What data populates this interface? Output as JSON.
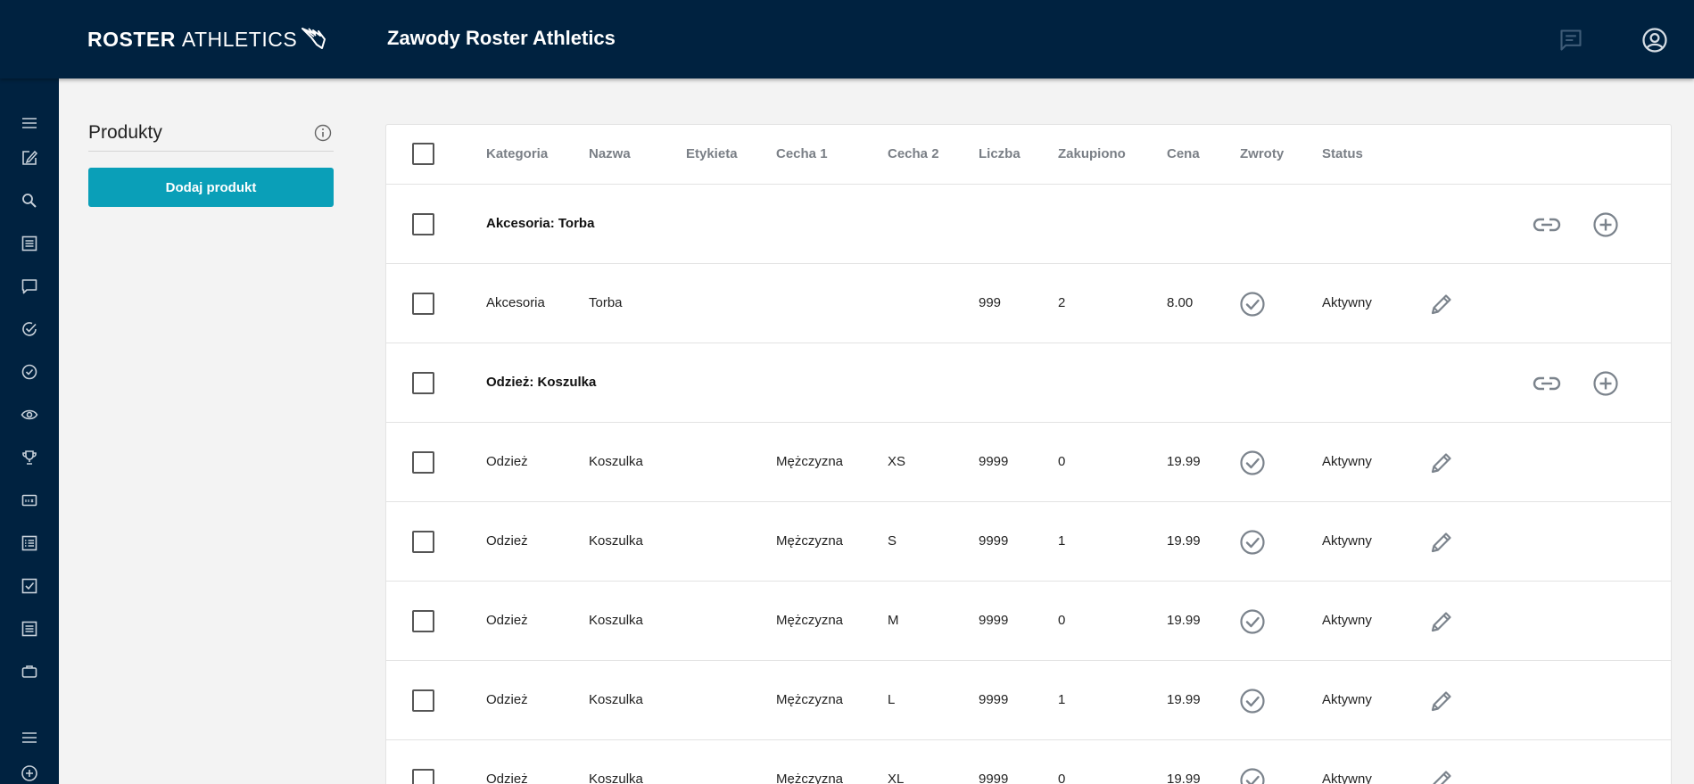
{
  "header": {
    "logo_bold": "ROSTER",
    "logo_light": "ATHLETICS",
    "title": "Zawody Roster Athletics",
    "icons": [
      "chat-icon",
      "account-icon"
    ]
  },
  "sidebar": {
    "icons": [
      "menu-icon",
      "edit-icon",
      "search-icon",
      "list-icon",
      "comment-icon",
      "check-circle-icon",
      "check-circle-outline-icon",
      "eye-icon",
      "trophy-icon",
      "bib-icon",
      "list-detail-icon",
      "checkbox-icon",
      "document-icon",
      "briefcase-icon",
      "menu-icon",
      "add-circle-icon"
    ]
  },
  "panel": {
    "title": "Produkty",
    "add_button": "Dodaj produkt"
  },
  "table": {
    "columns": [
      "Kategoria",
      "Nazwa",
      "Etykieta",
      "Cecha 1",
      "Cecha 2",
      "Liczba",
      "Zakupiono",
      "Cena",
      "Zwroty",
      "Status"
    ],
    "rows": [
      {
        "type": "group",
        "label": "Akcesoria: Torba"
      },
      {
        "type": "item",
        "kategoria": "Akcesoria",
        "nazwa": "Torba",
        "etykieta": "",
        "cecha1": "",
        "cecha2": "",
        "liczba": "999",
        "zakupiono": "2",
        "cena": "8.00",
        "status": "Aktywny"
      },
      {
        "type": "group",
        "label": "Odzież: Koszulka"
      },
      {
        "type": "item",
        "kategoria": "Odzież",
        "nazwa": "Koszulka",
        "etykieta": "",
        "cecha1": "Mężczyzna",
        "cecha2": "XS",
        "liczba": "9999",
        "zakupiono": "0",
        "cena": "19.99",
        "status": "Aktywny"
      },
      {
        "type": "item",
        "kategoria": "Odzież",
        "nazwa": "Koszulka",
        "etykieta": "",
        "cecha1": "Mężczyzna",
        "cecha2": "S",
        "liczba": "9999",
        "zakupiono": "1",
        "cena": "19.99",
        "status": "Aktywny"
      },
      {
        "type": "item",
        "kategoria": "Odzież",
        "nazwa": "Koszulka",
        "etykieta": "",
        "cecha1": "Mężczyzna",
        "cecha2": "M",
        "liczba": "9999",
        "zakupiono": "0",
        "cena": "19.99",
        "status": "Aktywny"
      },
      {
        "type": "item",
        "kategoria": "Odzież",
        "nazwa": "Koszulka",
        "etykieta": "",
        "cecha1": "Mężczyzna",
        "cecha2": "L",
        "liczba": "9999",
        "zakupiono": "1",
        "cena": "19.99",
        "status": "Aktywny"
      },
      {
        "type": "item",
        "kategoria": "Odzież",
        "nazwa": "Koszulka",
        "etykieta": "",
        "cecha1": "Mężczyzna",
        "cecha2": "XL",
        "liczba": "9999",
        "zakupiono": "0",
        "cena": "19.99",
        "status": "Aktywny"
      }
    ]
  },
  "colors": {
    "navy": "#002240",
    "accent": "#0a9fb8",
    "icon_gray": "#7b838c"
  }
}
